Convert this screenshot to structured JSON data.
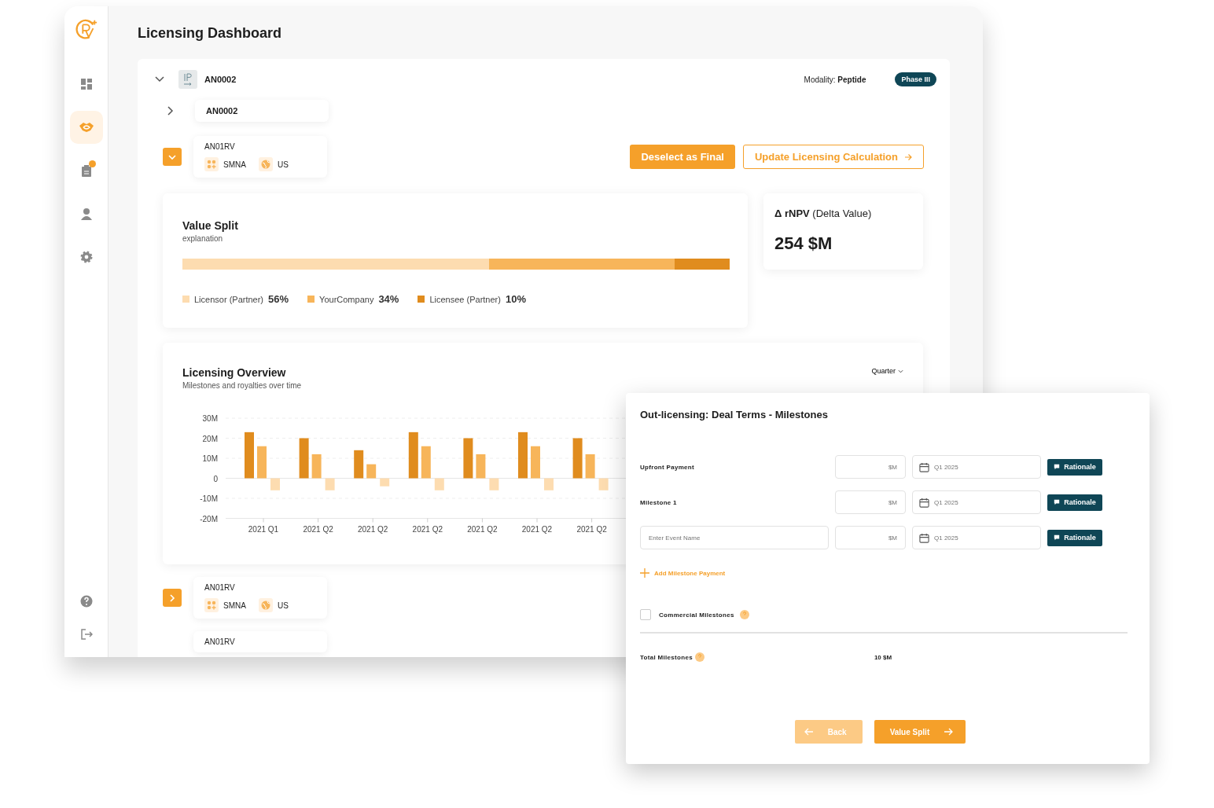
{
  "sidebar": {
    "items": [
      {
        "kind": "dashboard",
        "selected": false,
        "notification": false
      },
      {
        "kind": "deals",
        "selected": true,
        "notification": false
      },
      {
        "kind": "reports",
        "selected": false,
        "notification": true
      },
      {
        "kind": "user",
        "selected": false,
        "notification": false
      },
      {
        "kind": "settings",
        "selected": false,
        "notification": false
      }
    ],
    "bottom_items": [
      {
        "kind": "help"
      },
      {
        "kind": "logout"
      }
    ]
  },
  "page_title": "Licensing Dashboard",
  "asset": {
    "code": "AN0002",
    "modality": "Modality: **Peptide**",
    "phase": "Phase III",
    "expanded": true
  },
  "tree": [
    {
      "kind": "group",
      "code": "AN0002",
      "expanded": false
    },
    {
      "kind": "site",
      "code": "AN01RV",
      "tags": [
        {
          "kind": "company",
          "label": "SMNA"
        },
        {
          "kind": "country",
          "label": "US"
        }
      ],
      "expanded": true
    }
  ],
  "actions": [
    {
      "kind": "primary",
      "label": "Deselect as Final"
    },
    {
      "kind": "outline",
      "label": "Update Licensing Calculation"
    }
  ],
  "value_split": {
    "title": "Value Split",
    "subtitle": "explanation",
    "segments": [
      {
        "label": "Licensor (Partner)",
        "share": "56%",
        "color": "#fddcb0"
      },
      {
        "label": "YourCompany",
        "share": "34%",
        "color": "#f7b55a"
      },
      {
        "label": "Licensee (Partner)",
        "share": "10%",
        "color": "#e08c1e"
      }
    ]
  },
  "rnpv": {
    "title": "**Δ rNPV** (Delta Value)",
    "value": "254 $M"
  },
  "overview": {
    "title": "Licensing Overview",
    "subtitle": "Milestones and royalties over time",
    "period": "Quarter",
    "chart_data": {
      "type": "bar",
      "categories": [
        "2021 Q1",
        "2021 Q2",
        "2021 Q2",
        "2021 Q2",
        "2021 Q2",
        "2021 Q2",
        "2021 Q2"
      ],
      "series": [
        {
          "color": "#e08c1e",
          "values": [
            23,
            20,
            14,
            23,
            20,
            23,
            20
          ]
        },
        {
          "color": "#f7b55a",
          "values": [
            16,
            12,
            7,
            16,
            12,
            16,
            12
          ]
        },
        {
          "color": "#fddcb0",
          "values": [
            -6,
            -6,
            -4,
            -6,
            -6,
            -6,
            -6
          ]
        }
      ],
      "ylim": [
        -20,
        30
      ],
      "grid": true,
      "yticks": [
        {
          "value": 30,
          "label": "30M"
        },
        {
          "value": 20,
          "label": "20M"
        },
        {
          "value": 10,
          "label": "10M"
        },
        {
          "value": 0,
          "label": "0"
        },
        {
          "value": -10,
          "label": "-10M"
        },
        {
          "value": -20,
          "label": "-20M"
        }
      ]
    }
  },
  "tree_after": [
    {
      "kind": "site",
      "code": "AN01RV",
      "tags": [
        {
          "kind": "company",
          "label": "SMNA"
        },
        {
          "kind": "country",
          "label": "US"
        }
      ],
      "expanded": false
    },
    {
      "kind": "site",
      "code": "AN01RV"
    }
  ],
  "modal": {
    "title": "Out-licensing: Deal Terms - Milestones",
    "rows": [
      {
        "kind": "fixed",
        "label": "Upfront Payment",
        "amount_placeholder": "$M",
        "date_placeholder": "Q1 2025",
        "button": "Rationale"
      },
      {
        "kind": "fixed",
        "label": "Milestone 1",
        "amount_placeholder": "$M",
        "date_placeholder": "Q1 2025",
        "button": "Rationale"
      },
      {
        "kind": "input",
        "placeholder": "Enter Event Name",
        "amount_placeholder": "$M",
        "date_placeholder": "Q1 2025",
        "button": "Rationale"
      }
    ],
    "add_link": "Add Milestone Payment",
    "commercial": {
      "label": "Commercial Milestones",
      "checked": false
    },
    "total": {
      "label": "Total Milestones",
      "value": "10 $M"
    },
    "buttons": [
      {
        "kind": "back",
        "label": "Back",
        "disabled": true
      },
      {
        "kind": "next",
        "label": "Value Split",
        "disabled": false
      }
    ]
  }
}
